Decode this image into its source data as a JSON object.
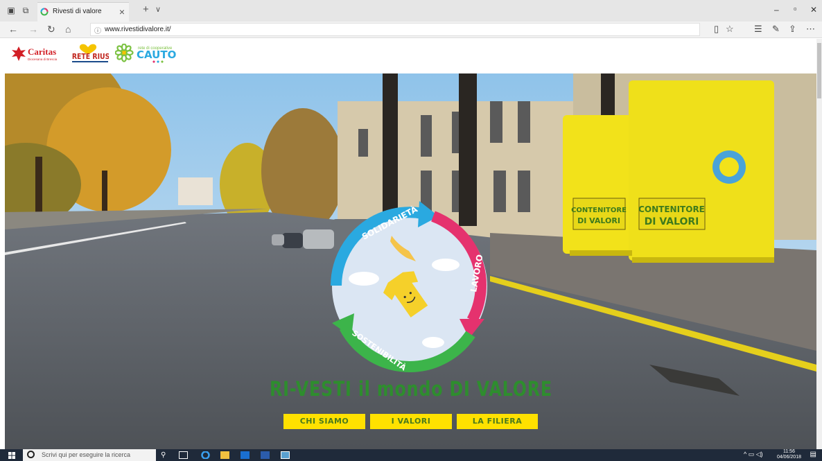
{
  "browser": {
    "tab_title": "Rivesti di valore",
    "tab_close": "×",
    "new_tab": "+",
    "tab_menu": "∨",
    "url": "www.rivestidivalore.it/",
    "win_min": "–",
    "win_max": "▫",
    "win_close": "✕"
  },
  "logos": {
    "caritas": "Caritas",
    "caritas_sub": "Diocesana di Brescia",
    "rete_riuse": "RETE RIUSE",
    "cauto_small": "rete di cooperative",
    "cauto": "CAUTO"
  },
  "hero": {
    "emblem_top": "SOLIDARIETÀ",
    "emblem_right": "LAVORO",
    "emblem_bottom": "SOSTENIBILITÀ",
    "bin_label_1": "CONTENITORE",
    "bin_label_2": "DI VALORI",
    "tagline": "RI-VESTI il mondo DI VALORE",
    "buttons": [
      "CHI SIAMO",
      "I VALORI",
      "LA FILIERA"
    ]
  },
  "taskbar": {
    "search_placeholder": "Scrivi qui per eseguire la ricerca",
    "time": "11:56",
    "date": "04/06/2018"
  },
  "colors": {
    "tagline": "#2e8d2e",
    "button_bg": "#ffe100",
    "button_text": "#4a7a1c",
    "bin_yellow": "#f2e21a",
    "arrow_blue": "#2aa9e0",
    "arrow_pink": "#e5326e",
    "arrow_green": "#3cb44a"
  }
}
